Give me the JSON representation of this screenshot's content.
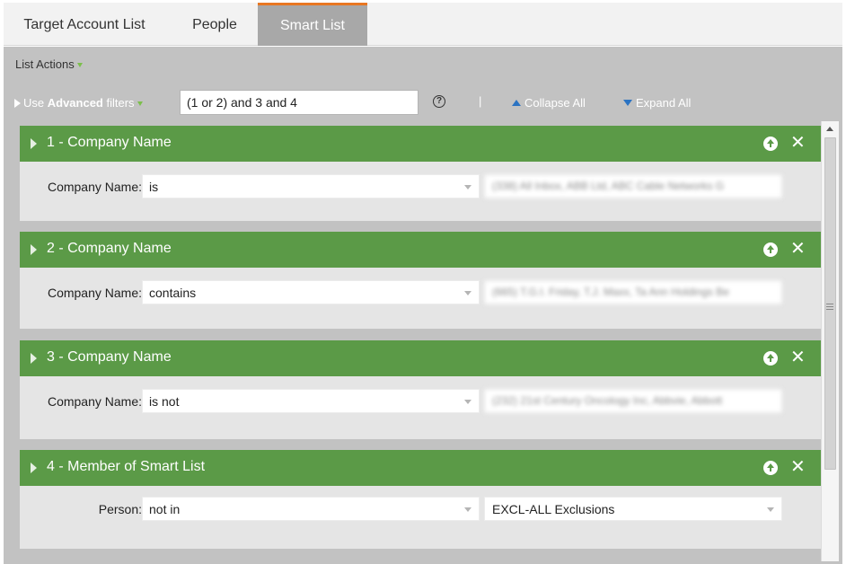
{
  "tabs": [
    {
      "label": "Target Account List"
    },
    {
      "label": "People"
    },
    {
      "label": "Smart List",
      "active": true
    }
  ],
  "list_actions": {
    "label": "List Actions"
  },
  "toolbar": {
    "use_prefix": "Use ",
    "advanced": "Advanced",
    "filters_suffix": " filters",
    "logic_value": "(1 or 2) and 3 and 4",
    "help_glyph": "?",
    "separator": "|",
    "collapse_label": "Collapse All",
    "expand_label": "Expand All"
  },
  "filters": [
    {
      "title": "1 - Company Name",
      "field_label": "Company Name:",
      "operator": "is",
      "value": "(338) All Inbox, ABB Ltd, ABC Cable Networks G",
      "value_blurred": true
    },
    {
      "title": "2 - Company Name",
      "field_label": "Company Name:",
      "operator": "contains",
      "value": "(665) T.G.I. Friday, T.J. Maxx, Ta Ann Holdings Be",
      "value_blurred": true
    },
    {
      "title": "3 - Company Name",
      "field_label": "Company Name:",
      "operator": "is not",
      "value": "(232) 21st Century Oncology Inc, Abbvie, Abbott",
      "value_blurred": true
    },
    {
      "title": "4 - Member of Smart List",
      "field_label": "Person:",
      "operator": "not in",
      "value": "EXCL-ALL Exclusions",
      "value_blurred": false
    }
  ],
  "icons": {
    "funnel": "funnel-icon",
    "move_up": "arrow-up-circle-icon",
    "close": "close-icon",
    "dropdown": "chevron-down-icon"
  },
  "colors": {
    "filter_header": "#5b9a47",
    "active_tab_accent": "#e87722",
    "link_blue": "#2b73c2",
    "canvas_gray": "#c2c2c2"
  }
}
